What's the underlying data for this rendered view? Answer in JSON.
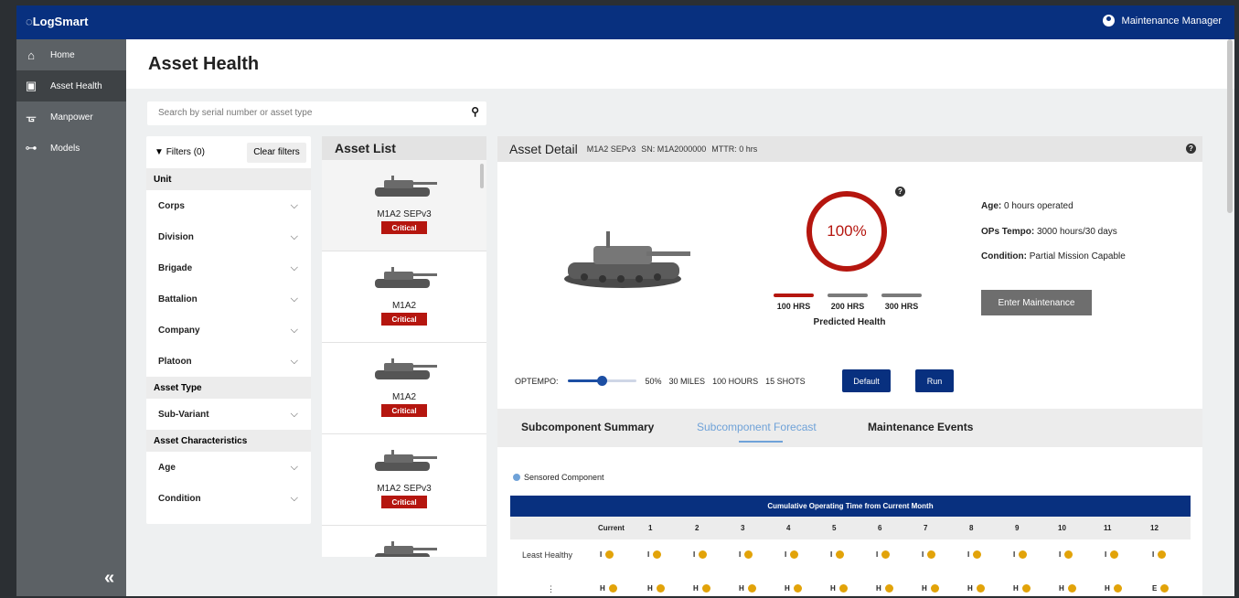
{
  "app": {
    "logo": "LogSmart",
    "user": "Maintenance Manager"
  },
  "nav": [
    {
      "label": "Home",
      "icon": "home-icon"
    },
    {
      "label": "Asset Health",
      "icon": "asset-health-icon"
    },
    {
      "label": "Manpower",
      "icon": "manpower-icon"
    },
    {
      "label": "Models",
      "icon": "models-icon"
    }
  ],
  "page": {
    "title": "Asset Health"
  },
  "search": {
    "placeholder": "Search by serial number or asset type"
  },
  "filters": {
    "label": "Filters (0)",
    "clear": "Clear filters",
    "unit_title": "Unit",
    "unit_items": [
      "Corps",
      "Division",
      "Brigade",
      "Battalion",
      "Company",
      "Platoon"
    ],
    "asset_type_title": "Asset Type",
    "asset_type_items": [
      "Sub-Variant"
    ],
    "characteristics_title": "Asset Characteristics",
    "characteristics_items": [
      "Age",
      "Condition"
    ]
  },
  "asset_list": {
    "title": "Asset List",
    "items": [
      {
        "name": "M1A2 SEPv3",
        "status": "Critical"
      },
      {
        "name": "M1A2",
        "status": "Critical"
      },
      {
        "name": "M1A2",
        "status": "Critical"
      },
      {
        "name": "M1A2 SEPv3",
        "status": "Critical"
      }
    ]
  },
  "detail": {
    "title": "Asset Detail",
    "model": "M1A2 SEPv3",
    "serial": "SN: M1A2000000",
    "mttr": "MTTR: 0 hrs",
    "health_percent": "100%",
    "hours": [
      "100 HRS",
      "200 HRS",
      "300 HRS"
    ],
    "predicted_label": "Predicted Health",
    "age_label": "Age:",
    "age_value": "0 hours operated",
    "tempo_label": "OPs Tempo:",
    "tempo_value": "3000 hours/30 days",
    "condition_label": "Condition:",
    "condition_value": "Partial Mission Capable",
    "enter_maintenance": "Enter Maintenance",
    "optempo_label": "OPTEMPO:",
    "optempo_level": 0.5,
    "optempo_pct": "50%",
    "miles": "30 MILES",
    "hours_val": "100 HOURS",
    "shots": "15 SHOTS",
    "default_btn": "Default",
    "run_btn": "Run"
  },
  "tabs": [
    "Subcomponent Summary",
    "Subcomponent Forecast",
    "Maintenance Events"
  ],
  "forecast": {
    "legend": "Sensored Component",
    "table_title": "Cumulative Operating Time from Current Month",
    "columns": [
      "Current",
      "1",
      "2",
      "3",
      "4",
      "5",
      "6",
      "7",
      "8",
      "9",
      "10",
      "11",
      "12"
    ],
    "rows": [
      {
        "label": "Least Healthy",
        "cells": [
          "I",
          "I",
          "I",
          "I",
          "I",
          "I",
          "I",
          "I",
          "I",
          "I",
          "I",
          "I",
          "I"
        ]
      },
      {
        "label": "⋮",
        "cells": [
          "H",
          "H",
          "H",
          "H",
          "H",
          "H",
          "H",
          "H",
          "H",
          "H",
          "H",
          "H",
          "E"
        ]
      }
    ]
  },
  "colors": {
    "brand": "#08307f",
    "critical": "#b5160f",
    "accent": "#6fa2d8",
    "dot": "#e2a309"
  }
}
